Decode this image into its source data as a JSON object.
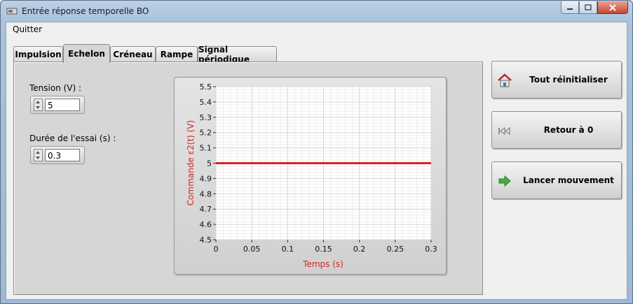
{
  "window": {
    "title": "Entrée réponse temporelle BO"
  },
  "menu": {
    "quit": "Quitter"
  },
  "tabs": [
    {
      "label": "Impulsion"
    },
    {
      "label": "Echelon"
    },
    {
      "label": "Créneau"
    },
    {
      "label": "Rampe"
    },
    {
      "label": "Signal périodique"
    }
  ],
  "active_tab": "Echelon",
  "controls": {
    "tension_label": "Tension  (V) :",
    "tension_value": "5",
    "duree_label": "Durée de l'essai (s) :",
    "duree_value": "0.3"
  },
  "buttons": {
    "reset": "Tout réinitialiser",
    "return": "Retour à 0",
    "start": "Lancer mouvement"
  },
  "chart_data": {
    "type": "line",
    "xlabel": "Temps (s)",
    "ylabel": "Commande ε2(t) (V)",
    "xlim": [
      0,
      0.3
    ],
    "ylim": [
      4.5,
      5.5
    ],
    "x_ticks": [
      "0",
      "0.05",
      "0.1",
      "0.15",
      "0.2",
      "0.25",
      "0.3"
    ],
    "y_ticks": [
      "5.5",
      "5.4",
      "5.3",
      "5.2",
      "5.1",
      "5",
      "4.9",
      "4.8",
      "4.7",
      "4.6",
      "4.5"
    ],
    "grid": true,
    "series": [
      {
        "x": [
          0,
          0.3
        ],
        "y": [
          5,
          5
        ],
        "color": "#e0201a"
      }
    ],
    "label_color": "#d8231c"
  }
}
